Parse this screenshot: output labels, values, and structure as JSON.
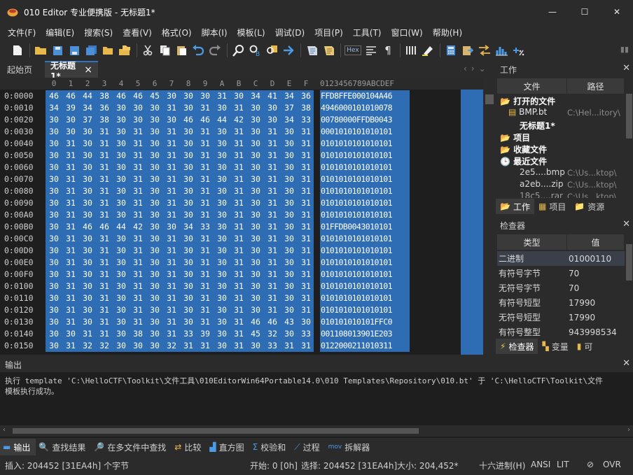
{
  "window": {
    "title": "010 Editor 专业便携版 - 无标题1*",
    "minimize": "—",
    "maximize": "☐",
    "close": "✕"
  },
  "menu": [
    "文件(F)",
    "编辑(E)",
    "搜索(S)",
    "查看(V)",
    "格式(O)",
    "脚本(I)",
    "模板(L)",
    "调试(D)",
    "项目(P)",
    "工具(T)",
    "窗口(W)",
    "帮助(H)"
  ],
  "toolbar_icons": [
    "new-file-icon",
    "open-folder-icon",
    "save-icon",
    "save-as-icon",
    "save-all-icon",
    "open-folder-icon",
    "folder-group-icon",
    "cut-icon",
    "copy-icon",
    "paste-icon",
    "undo-icon",
    "redo-icon",
    "find-icon",
    "replace-icon",
    "find-in-files-icon",
    "goto-icon",
    "script-icon",
    "template-icon",
    "hex-mode-icon",
    "text-format-icon",
    "paragraph-icon",
    "columns-icon",
    "highlight-icon",
    "calculator-icon",
    "clipboard-icon",
    "compare-icon",
    "histogram-icon",
    "checksum-icon"
  ],
  "toolbar_hex_label": "Hex",
  "tabs": {
    "home": "起始页",
    "file": "无标题1*",
    "close": "×"
  },
  "hex": {
    "header_cols": [
      "0",
      "1",
      "2",
      "3",
      "4",
      "5",
      "6",
      "7",
      "8",
      "9",
      "A",
      "B",
      "C",
      "D",
      "E",
      "F"
    ],
    "ascii_header": "0123456789ABCDEF",
    "rows": [
      {
        "addr": "0:0000",
        "bytes": [
          "46",
          "46",
          "44",
          "38",
          "46",
          "46",
          "45",
          "30",
          "30",
          "30",
          "31",
          "30",
          "34",
          "41",
          "34",
          "36"
        ],
        "ascii": "FFD8FFE000104A46"
      },
      {
        "addr": "0:0010",
        "bytes": [
          "34",
          "39",
          "34",
          "36",
          "30",
          "30",
          "30",
          "31",
          "30",
          "31",
          "30",
          "31",
          "30",
          "30",
          "37",
          "38"
        ],
        "ascii": "4946000101010078"
      },
      {
        "addr": "0:0020",
        "bytes": [
          "30",
          "30",
          "37",
          "38",
          "30",
          "30",
          "30",
          "30",
          "46",
          "46",
          "44",
          "42",
          "30",
          "30",
          "34",
          "33"
        ],
        "ascii": "00780000FFDB0043"
      },
      {
        "addr": "0:0030",
        "bytes": [
          "30",
          "30",
          "30",
          "31",
          "30",
          "31",
          "30",
          "31",
          "30",
          "31",
          "30",
          "31",
          "30",
          "31",
          "30",
          "31"
        ],
        "ascii": "0001010101010101"
      },
      {
        "addr": "0:0040",
        "bytes": [
          "30",
          "31",
          "30",
          "31",
          "30",
          "31",
          "30",
          "31",
          "30",
          "31",
          "30",
          "31",
          "30",
          "31",
          "30",
          "31"
        ],
        "ascii": "0101010101010101"
      },
      {
        "addr": "0:0050",
        "bytes": [
          "30",
          "31",
          "30",
          "31",
          "30",
          "31",
          "30",
          "31",
          "30",
          "31",
          "30",
          "31",
          "30",
          "31",
          "30",
          "31"
        ],
        "ascii": "0101010101010101"
      },
      {
        "addr": "0:0060",
        "bytes": [
          "30",
          "31",
          "30",
          "31",
          "30",
          "31",
          "30",
          "31",
          "30",
          "31",
          "30",
          "31",
          "30",
          "31",
          "30",
          "31"
        ],
        "ascii": "0101010101010101"
      },
      {
        "addr": "0:0070",
        "bytes": [
          "30",
          "31",
          "30",
          "31",
          "30",
          "31",
          "30",
          "31",
          "30",
          "31",
          "30",
          "31",
          "30",
          "31",
          "30",
          "31"
        ],
        "ascii": "0101010101010101"
      },
      {
        "addr": "0:0080",
        "bytes": [
          "30",
          "31",
          "30",
          "31",
          "30",
          "31",
          "30",
          "31",
          "30",
          "31",
          "30",
          "31",
          "30",
          "31",
          "30",
          "31"
        ],
        "ascii": "0101010101010101"
      },
      {
        "addr": "0:0090",
        "bytes": [
          "30",
          "31",
          "30",
          "31",
          "30",
          "31",
          "30",
          "31",
          "30",
          "31",
          "30",
          "31",
          "30",
          "31",
          "30",
          "31"
        ],
        "ascii": "0101010101010101"
      },
      {
        "addr": "0:00A0",
        "bytes": [
          "30",
          "31",
          "30",
          "31",
          "30",
          "31",
          "30",
          "31",
          "30",
          "31",
          "30",
          "31",
          "30",
          "31",
          "30",
          "31"
        ],
        "ascii": "0101010101010101"
      },
      {
        "addr": "0:00B0",
        "bytes": [
          "30",
          "31",
          "46",
          "46",
          "44",
          "42",
          "30",
          "30",
          "34",
          "33",
          "30",
          "31",
          "30",
          "31",
          "30",
          "31"
        ],
        "ascii": "01FFDB0043010101"
      },
      {
        "addr": "0:00C0",
        "bytes": [
          "30",
          "31",
          "30",
          "31",
          "30",
          "31",
          "30",
          "31",
          "30",
          "31",
          "30",
          "31",
          "30",
          "31",
          "30",
          "31"
        ],
        "ascii": "0101010101010101"
      },
      {
        "addr": "0:00D0",
        "bytes": [
          "30",
          "31",
          "30",
          "31",
          "30",
          "31",
          "30",
          "31",
          "30",
          "31",
          "30",
          "31",
          "30",
          "31",
          "30",
          "31"
        ],
        "ascii": "0101010101010101"
      },
      {
        "addr": "0:00E0",
        "bytes": [
          "30",
          "31",
          "30",
          "31",
          "30",
          "31",
          "30",
          "31",
          "30",
          "31",
          "30",
          "31",
          "30",
          "31",
          "30",
          "31"
        ],
        "ascii": "0101010101010101"
      },
      {
        "addr": "0:00F0",
        "bytes": [
          "30",
          "31",
          "30",
          "31",
          "30",
          "31",
          "30",
          "31",
          "30",
          "31",
          "30",
          "31",
          "30",
          "31",
          "30",
          "31"
        ],
        "ascii": "0101010101010101"
      },
      {
        "addr": "0:0100",
        "bytes": [
          "30",
          "31",
          "30",
          "31",
          "30",
          "31",
          "30",
          "31",
          "30",
          "31",
          "30",
          "31",
          "30",
          "31",
          "30",
          "31"
        ],
        "ascii": "0101010101010101"
      },
      {
        "addr": "0:0110",
        "bytes": [
          "30",
          "31",
          "30",
          "31",
          "30",
          "31",
          "30",
          "31",
          "30",
          "31",
          "30",
          "31",
          "30",
          "31",
          "30",
          "31"
        ],
        "ascii": "0101010101010101"
      },
      {
        "addr": "0:0120",
        "bytes": [
          "30",
          "31",
          "30",
          "31",
          "30",
          "31",
          "30",
          "31",
          "30",
          "31",
          "30",
          "31",
          "30",
          "31",
          "30",
          "31"
        ],
        "ascii": "0101010101010101"
      },
      {
        "addr": "0:0130",
        "bytes": [
          "30",
          "31",
          "30",
          "31",
          "30",
          "31",
          "30",
          "31",
          "30",
          "31",
          "30",
          "31",
          "46",
          "46",
          "43",
          "30"
        ],
        "ascii": "010101010101FFC0"
      },
      {
        "addr": "0:0140",
        "bytes": [
          "30",
          "30",
          "31",
          "31",
          "30",
          "38",
          "30",
          "31",
          "33",
          "39",
          "30",
          "31",
          "45",
          "32",
          "30",
          "33"
        ],
        "ascii": "001108013901E203"
      },
      {
        "addr": "0:0150",
        "bytes": [
          "30",
          "31",
          "32",
          "32",
          "30",
          "30",
          "30",
          "32",
          "31",
          "31",
          "30",
          "31",
          "30",
          "33",
          "31",
          "31"
        ],
        "ascii": "0122000211010311"
      }
    ]
  },
  "workspace": {
    "title": "工作",
    "close": "✕",
    "col_file": "文件",
    "col_path": "路径",
    "open_files_label": "打开的文件",
    "files": [
      {
        "name": "BMP.bt",
        "path": "C:\\Hel...itory\\"
      },
      {
        "name": "无标题1*",
        "path": ""
      }
    ],
    "project_label": "项目",
    "favorites_label": "收藏文件",
    "recent_label": "最近文件",
    "recent": [
      {
        "name": "2e5....bmp",
        "path": "C:\\Us...ktop\\"
      },
      {
        "name": "a2eb....zip",
        "path": "C:\\Us...ktop\\"
      },
      {
        "name": "18c5....rar",
        "path": "C:\\Us...ktop\\"
      }
    ],
    "tabs": [
      "工作",
      "项目",
      "资源"
    ]
  },
  "inspector": {
    "title": "检查器",
    "close": "✕",
    "col_type": "类型",
    "col_value": "值",
    "rows": [
      {
        "type": "二进制",
        "value": "01000110"
      },
      {
        "type": "有符号字节",
        "value": "70"
      },
      {
        "type": "无符号字节",
        "value": "70"
      },
      {
        "type": "有符号短型",
        "value": "17990"
      },
      {
        "type": "无符号短型",
        "value": "17990"
      },
      {
        "type": "有符号整型",
        "value": "943998534"
      }
    ],
    "tabs": [
      "检查器",
      "变量",
      "可"
    ]
  },
  "output": {
    "title": "输出",
    "close": "✕",
    "line1": "执行 template 'C:\\HelloCTF\\Toolkit\\文件工具\\010EditorWin64Portable14.0\\010 Templates\\Repository\\010.bt' 于 'C:\\HelloCTF\\Toolkit\\文件",
    "line2": "模板执行成功。"
  },
  "bottom_tabs": [
    "输出",
    "查找结果",
    "在多文件中查找",
    "比较",
    "直方图",
    "校验和",
    "过程",
    "拆解器"
  ],
  "status": {
    "insert": "插入: 204452 [31EA4h] 个字节",
    "start": "开始: 0 [0h]",
    "selection": "选择: 204452 [31EA4h]",
    "size": "大小: 204,452*",
    "mode": "十六进制(H)",
    "encoding": "ANSI",
    "endian": "LIT",
    "ovr": "OVR"
  },
  "colors": {
    "selection": "#2e6db4",
    "background": "#1e1e1e",
    "chrome": "#2b2b2b"
  }
}
